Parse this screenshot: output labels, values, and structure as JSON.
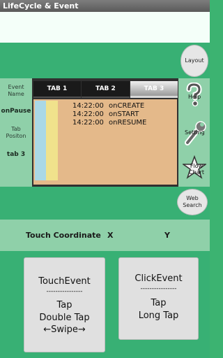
{
  "app_title": "LifeCycle & Event",
  "buttons": {
    "layout": "Layout",
    "web_search_line1": "Web",
    "web_search_line2": "Search"
  },
  "left_panel": {
    "event_name_line1": "Event",
    "event_name_line2": "Name",
    "event_value": "onPause",
    "tab_position_line1": "Tab",
    "tab_position_line2": "Positon",
    "tab_value": "tab 3"
  },
  "tabs": [
    "TAB 1",
    "TAB 2",
    "TAB 3"
  ],
  "log": [
    {
      "time": "14:22:00",
      "event": "onCREATE"
    },
    {
      "time": "14:22:00",
      "event": "onSTART"
    },
    {
      "time": "14:22:00",
      "event": "onRESUME"
    }
  ],
  "right_panel": {
    "help": "Help",
    "setting": "Setting",
    "flow_chart_line1": "Flow",
    "flow_chart_line2": "Chart"
  },
  "touch_coordinate": {
    "label": "Touch Coordinate",
    "x": "X",
    "y": "Y"
  },
  "touch_event": {
    "title": "TouchEvent",
    "separator": "----------------",
    "tap": "Tap",
    "double_tap": "Double Tap",
    "swipe": "←Swipe→"
  },
  "click_event": {
    "title": "ClickEvent",
    "separator": "----------------",
    "tap": "Tap",
    "long_tap": "Long Tap"
  },
  "colors": {
    "background": "#38b074",
    "side_panel": "#8fd0a9",
    "log_background": "#e4b98a",
    "tab_bar": "#303030"
  }
}
